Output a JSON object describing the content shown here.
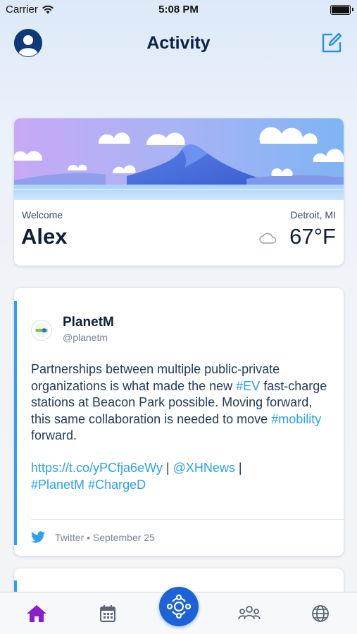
{
  "status_bar": {
    "carrier": "Carrier",
    "time": "5:08 PM"
  },
  "header": {
    "title": "Activity"
  },
  "welcome_card": {
    "greeting": "Welcome",
    "name": "Alex",
    "location": "Detroit, MI",
    "temperature": "67°F",
    "weather_icon": "cloud-icon"
  },
  "tweet": {
    "author": "PlanetM",
    "handle": "@planetm",
    "text_parts": [
      "Partnerships between multiple public-private organizations is what made the new ",
      "#EV",
      " fast-charge stations at Beacon Park possible. Moving forward, this same collaboration is needed to move ",
      "#mobility",
      " forward."
    ],
    "link": "https://t.co/yPCfja6eWy",
    "separator_1": " | ",
    "mention": "@XHNews",
    "separator_2": " |",
    "hashtag_1": "#PlanetM",
    "hashtag_2": "#ChargeD",
    "source": "Twitter",
    "dot": "•",
    "date": "September 25"
  },
  "tab_bar": {
    "items": [
      "home-icon",
      "calendar-icon",
      "hub-icon",
      "people-icon",
      "globe-icon"
    ],
    "active": "home",
    "active_color": "#8e1cc9",
    "inactive_color": "#5b6576",
    "center_color": "#1d63d8"
  },
  "colors": {
    "link": "#2ba1ec",
    "accent_bar": "#2f9fef",
    "title": "#0e2242"
  }
}
